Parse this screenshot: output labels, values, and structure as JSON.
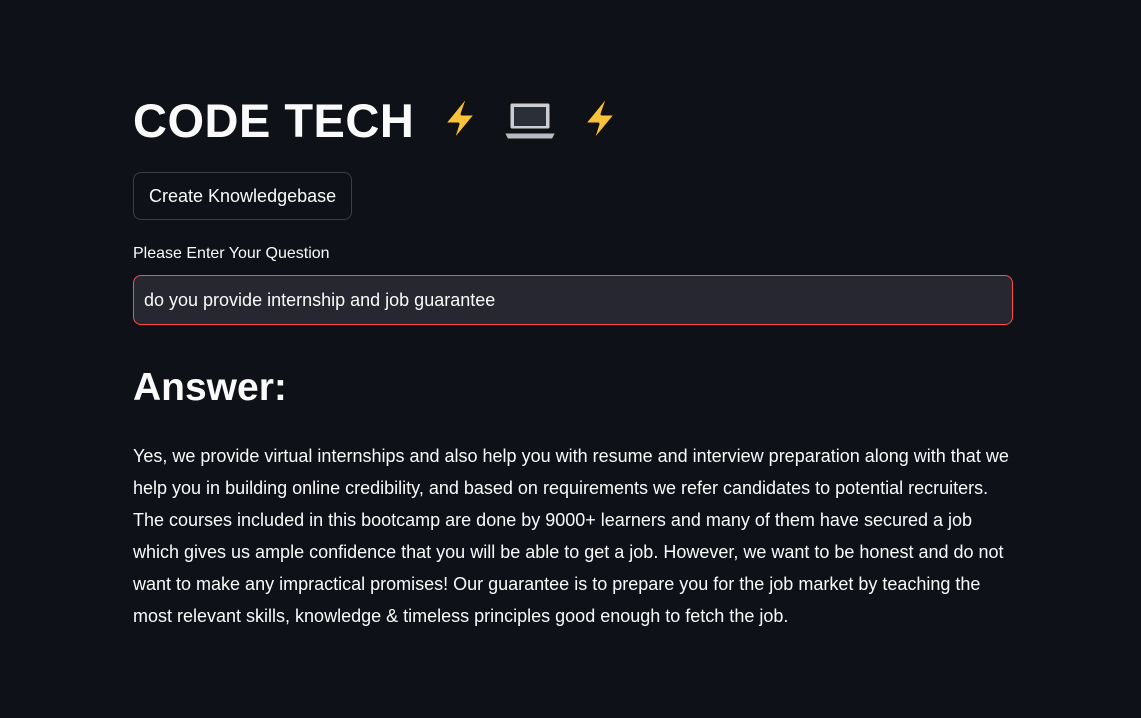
{
  "header": {
    "title": "CODE TECH",
    "emojis": [
      "lightning-icon",
      "laptop-icon",
      "lightning-icon"
    ]
  },
  "knowledgebase_button": {
    "label": "Create Knowledgebase"
  },
  "question": {
    "label": "Please Enter Your Question",
    "value": "do you provide internship and job guarantee"
  },
  "answer": {
    "heading": "Answer:",
    "text": "Yes, we provide virtual internships and also help you with resume and interview preparation along with that we help you in building online credibility, and based on requirements we refer candidates to potential recruiters. The courses included in this bootcamp are done by 9000+ learners and many of them have secured a job which gives us ample confidence that you will be able to get a job. However, we want to be honest and do not want to make any impractical promises! Our guarantee is to prepare you for the job market by teaching the most relevant skills, knowledge & timeless principles good enough to fetch the job."
  },
  "colors": {
    "background": "#0e1117",
    "input_background": "#262730",
    "input_focus_border": "#ff4b4b",
    "text": "#fafafa"
  }
}
